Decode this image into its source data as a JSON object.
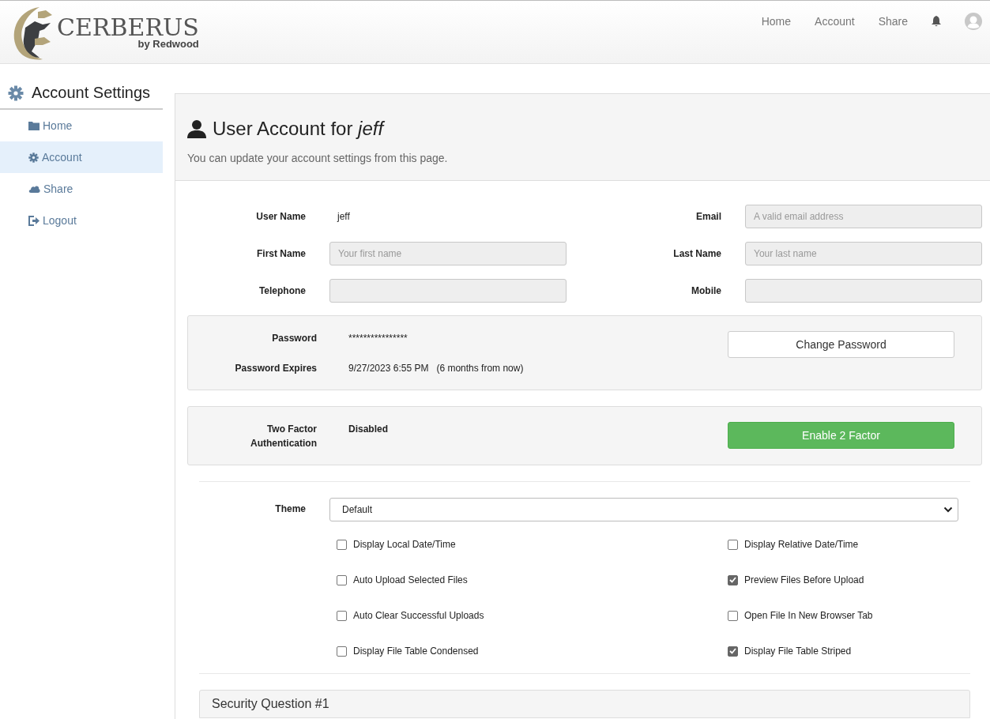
{
  "brand": {
    "name": "CERBERUS",
    "tagline": "by Redwood"
  },
  "nav": [
    {
      "label": "Home",
      "kind": "text"
    },
    {
      "label": "Account",
      "kind": "text"
    },
    {
      "label": "Share",
      "kind": "text"
    },
    {
      "kind": "bell"
    },
    {
      "kind": "avatar"
    }
  ],
  "sidebar": {
    "title": "Account Settings",
    "items": [
      {
        "label": "Home",
        "kind": "folder",
        "selected": false
      },
      {
        "label": "Account",
        "kind": "gear",
        "selected": true
      },
      {
        "label": "Share",
        "kind": "cloud",
        "selected": false
      },
      {
        "label": "Logout",
        "kind": "logout",
        "selected": false
      }
    ]
  },
  "header": {
    "title": "User Account for *jeff*",
    "subtitle": "You can update your account settings from this page."
  },
  "fields": [
    {
      "label": "User Name",
      "kind": "static",
      "value": "jeff"
    },
    {
      "label": "Email",
      "kind": "input",
      "placeholder": "A valid email address"
    },
    {
      "label": "First Name",
      "kind": "input",
      "placeholder": "Your first name"
    },
    {
      "label": "Last Name",
      "kind": "input",
      "placeholder": "Your last name"
    },
    {
      "label": "Telephone",
      "kind": "input"
    },
    {
      "label": "Mobile",
      "kind": "input"
    }
  ],
  "password": {
    "rows": [
      {
        "label": "Password",
        "value": "****************"
      },
      {
        "label": "Password Expires",
        "value": "9/27/2023 6:55 PM   (6 months from now)"
      }
    ],
    "button": "Change Password"
  },
  "two_factor": {
    "label": "Two Factor Authentication",
    "status": "Disabled",
    "button": "Enable 2 Factor"
  },
  "theme": {
    "label": "Theme",
    "value": "Default"
  },
  "options": [
    {
      "label": "Display Local Date/Time",
      "checked": false
    },
    {
      "label": "Display Relative Date/Time",
      "checked": false
    },
    {
      "label": "Auto Upload Selected Files",
      "checked": false
    },
    {
      "label": "Preview Files Before Upload",
      "checked": true
    },
    {
      "label": "Auto Clear Successful Uploads",
      "checked": false
    },
    {
      "label": "Open File In New Browser Tab",
      "checked": false
    },
    {
      "label": "Display File Table Condensed",
      "checked": false
    },
    {
      "label": "Display File Table Striped",
      "checked": true
    }
  ],
  "security_panel": {
    "title": "Security Question #1"
  }
}
